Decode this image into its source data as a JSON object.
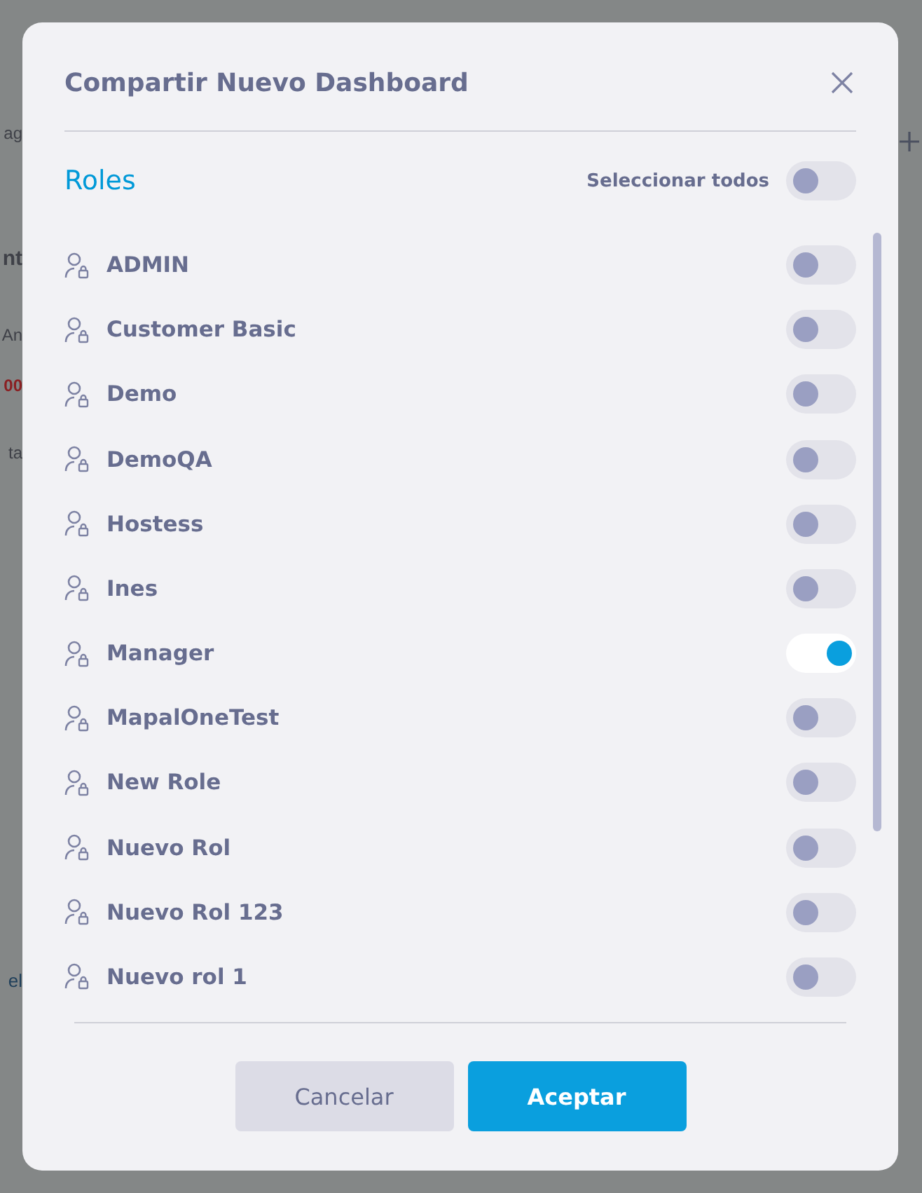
{
  "background": {
    "fragments": [
      "ag",
      "nt",
      "An",
      "00",
      "ta",
      "el"
    ]
  },
  "dialog": {
    "title": "Compartir Nuevo Dashboard",
    "section_title": "Roles",
    "select_all": {
      "label": "Seleccionar todos",
      "on": false
    },
    "roles": [
      {
        "name": "ADMIN",
        "on": false
      },
      {
        "name": "Customer Basic",
        "on": false
      },
      {
        "name": "Demo",
        "on": false
      },
      {
        "name": "DemoQA",
        "on": false
      },
      {
        "name": "Hostess",
        "on": false
      },
      {
        "name": "Ines",
        "on": false
      },
      {
        "name": "Manager",
        "on": true
      },
      {
        "name": "MapalOneTest",
        "on": false
      },
      {
        "name": "New Role",
        "on": false
      },
      {
        "name": "Nuevo Rol",
        "on": false
      },
      {
        "name": "Nuevo Rol 123",
        "on": false
      },
      {
        "name": "Nuevo rol 1",
        "on": false
      }
    ],
    "buttons": [
      {
        "label": "Cancelar",
        "kind": "secondary"
      },
      {
        "label": "Aceptar",
        "kind": "primary"
      }
    ]
  }
}
